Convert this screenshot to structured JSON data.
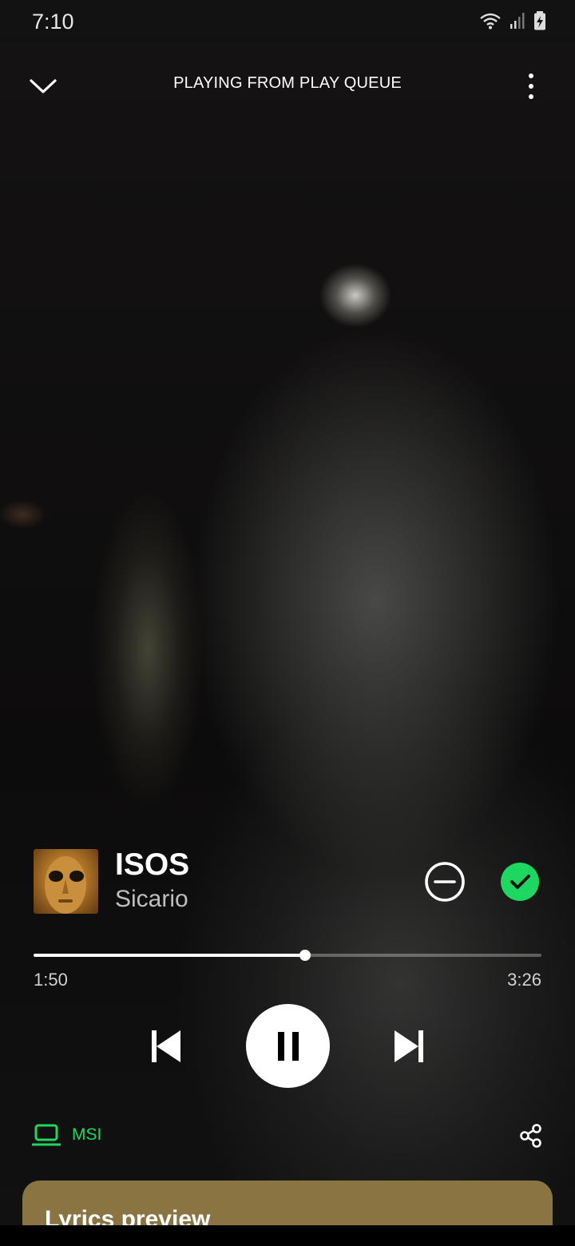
{
  "status_bar": {
    "time": "7:10",
    "icons": [
      "wifi-icon",
      "signal-icon",
      "battery-charging-icon"
    ]
  },
  "header": {
    "collapse_icon": "chevron-down-icon",
    "context_label": "PLAYING FROM PLAY QUEUE",
    "menu_icon": "more-vertical-icon"
  },
  "track": {
    "title": "ISOS",
    "artist": "Sicario",
    "remove_icon": "minus-circle-icon",
    "liked_icon": "check-circle-icon",
    "liked_color": "#1ed760"
  },
  "playback": {
    "elapsed": "1:50",
    "duration": "3:26",
    "progress_fraction": 0.534
  },
  "controls": {
    "previous_icon": "skip-previous-icon",
    "play_state_icon": "pause-icon",
    "next_icon": "skip-next-icon"
  },
  "device": {
    "icon": "laptop-icon",
    "name": "MSI",
    "color": "#1ed760"
  },
  "share_icon": "share-icon",
  "lyrics": {
    "title": "Lyrics preview",
    "card_color": "#8a7442"
  }
}
